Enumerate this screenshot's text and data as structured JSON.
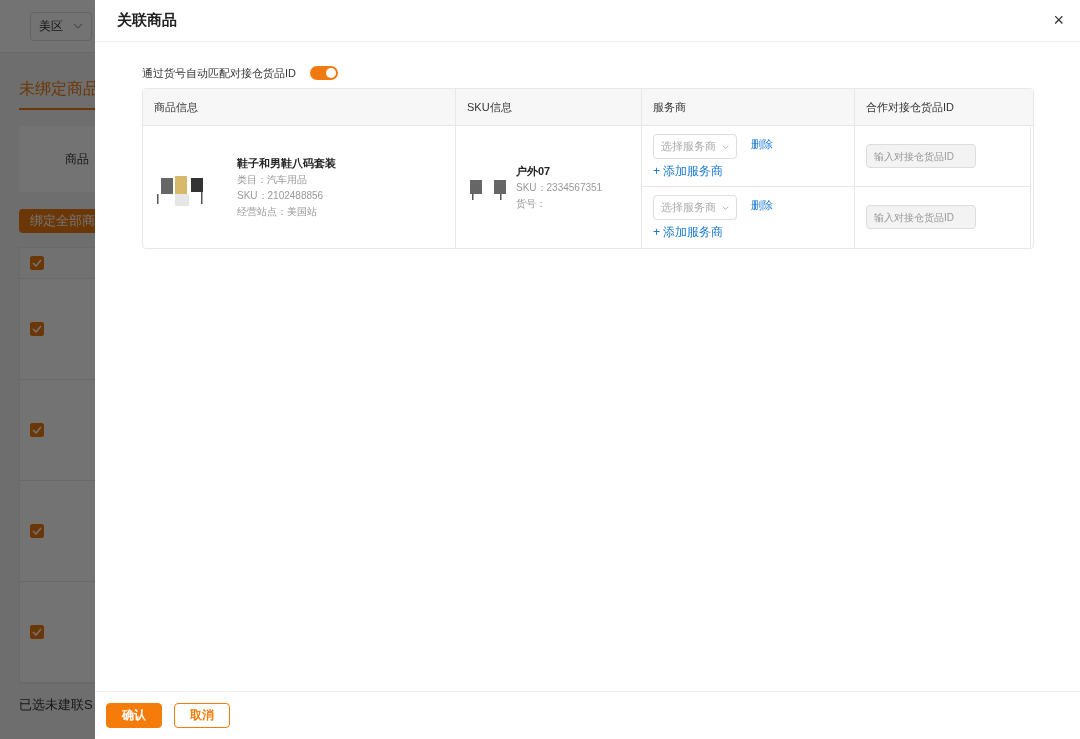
{
  "background_page": {
    "region_select": "美区",
    "tab": {
      "label": "未绑定商品",
      "selected": true
    },
    "filter_label": "商品",
    "bind_all_button": "绑定全部商",
    "header_checkbox": {
      "checked": true
    },
    "rows": [
      {
        "checked": true
      },
      {
        "checked": true
      },
      {
        "checked": true
      },
      {
        "checked": true
      }
    ],
    "footer_text": "已选未建联S"
  },
  "drawer": {
    "title": "关联商品",
    "close": "×",
    "auto_match": {
      "label": "通过货号自动匹配对接仓货品ID",
      "on": true
    },
    "table": {
      "columns": [
        "商品信息",
        "SKU信息",
        "服务商",
        "合作对接仓货品ID"
      ],
      "rows": [
        {
          "product": {
            "title": "鞋子和男鞋八码套装",
            "lines": [
              "类目：汽车用品",
              "SKU：2102488856",
              "经营站点：美国站"
            ]
          },
          "sku": {
            "title": "户外07",
            "lines": [
              "SKU：2334567351",
              "货号："
            ]
          },
          "providers": [
            {
              "select_placeholder": "选择服务商",
              "delete": "删除",
              "add": "+ 添加服务商",
              "id_placeholder": "输入对接仓货品ID"
            },
            {
              "select_placeholder": "选择服务商",
              "delete": "删除",
              "add": "+ 添加服务商",
              "id_placeholder": "输入对接仓货品ID"
            }
          ]
        }
      ]
    },
    "buttons": [
      {
        "label": "确认",
        "kind": "primary"
      },
      {
        "label": "取消",
        "kind": "secondary"
      }
    ]
  }
}
